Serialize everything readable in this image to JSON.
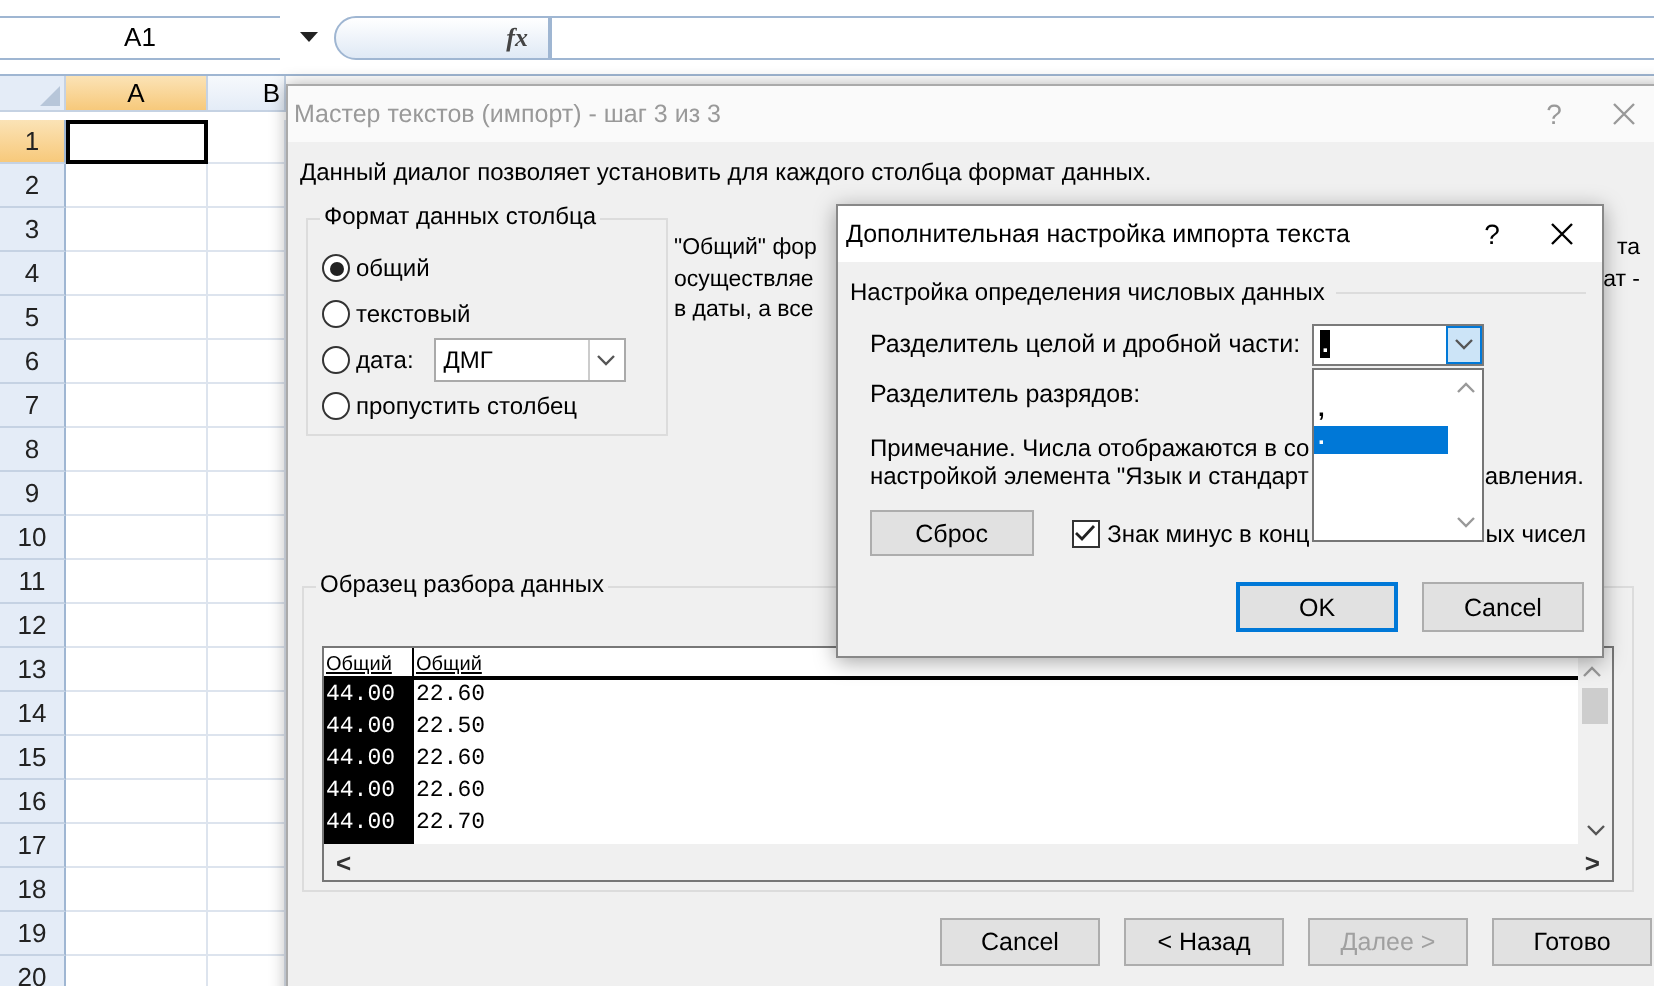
{
  "spreadsheet": {
    "name_box": "A1",
    "function_label": "fx",
    "columns": [
      {
        "label": "A",
        "selected": true
      },
      {
        "label": "B",
        "selected": false
      }
    ],
    "rows": [
      {
        "label": "1",
        "selected": true
      },
      {
        "label": "2",
        "selected": false
      },
      {
        "label": "3",
        "selected": false
      },
      {
        "label": "4",
        "selected": false
      },
      {
        "label": "5",
        "selected": false
      },
      {
        "label": "6",
        "selected": false
      },
      {
        "label": "7",
        "selected": false
      },
      {
        "label": "8",
        "selected": false
      },
      {
        "label": "9",
        "selected": false
      },
      {
        "label": "10",
        "selected": false
      },
      {
        "label": "11",
        "selected": false
      },
      {
        "label": "12",
        "selected": false
      },
      {
        "label": "13",
        "selected": false
      },
      {
        "label": "14",
        "selected": false
      },
      {
        "label": "15",
        "selected": false
      },
      {
        "label": "16",
        "selected": false
      },
      {
        "label": "17",
        "selected": false
      },
      {
        "label": "18",
        "selected": false
      },
      {
        "label": "19",
        "selected": false
      },
      {
        "label": "20",
        "selected": false
      }
    ]
  },
  "wizard": {
    "title": "Мастер текстов (импорт) - шаг 3 из 3",
    "help": "?",
    "intro": "Данный диалог позволяет установить для каждого столбца формат данных.",
    "format_group": {
      "legend": "Формат данных столбца",
      "date_format": "ДМГ",
      "options": [
        {
          "label": "общий",
          "selected": true,
          "kind": "plain"
        },
        {
          "label": "текстовый",
          "selected": false,
          "kind": "plain"
        },
        {
          "label": "дата:",
          "selected": false,
          "kind": "date"
        },
        {
          "label": "пропустить столбец",
          "selected": false,
          "kind": "plain"
        }
      ]
    },
    "description": {
      "left_lines": [
        "\"Общий\" фор",
        "осуществляе",
        "в даты, а все"
      ],
      "right_lines": [
        "та",
        "ат -"
      ]
    },
    "preview": {
      "legend": "Образец разбора данных",
      "columns": [
        {
          "header": "Общий",
          "selected": true,
          "values": [
            "44.00",
            "44.00",
            "44.00",
            "44.00",
            "44.00"
          ]
        },
        {
          "header": "Общий",
          "selected": false,
          "values": [
            "22.60",
            "22.50",
            "22.60",
            "22.60",
            "22.70"
          ]
        }
      ],
      "scroll_left": "<",
      "scroll_right": ">"
    },
    "buttons": [
      {
        "label": "Cancel",
        "disabled": false
      },
      {
        "label": "< Назад",
        "disabled": false
      },
      {
        "label": "Далее >",
        "disabled": true
      },
      {
        "label": "Готово",
        "disabled": false
      }
    ]
  },
  "advanced_dialog": {
    "title": "Дополнительная настройка импорта текста",
    "help": "?",
    "group_legend": "Настройка определения числовых данных",
    "decimal_separator": {
      "label": "Разделитель целой и дробной части:",
      "value": ".",
      "options": [
        {
          "label": ",",
          "selected": false
        },
        {
          "label": ".",
          "selected": true
        }
      ]
    },
    "thousands_separator": {
      "label": "Разделитель разрядов:"
    },
    "note_lines": [
      {
        "before": "Примечание. Числа отображаются в со"
      },
      {
        "before": "настройкой элемента \"Язык и стандарт",
        "after": "авления."
      }
    ],
    "reset": "Сброс",
    "minus_checkbox": {
      "checked": true,
      "before": "Знак минус в конц",
      "after": "ых чисел"
    },
    "buttons": [
      {
        "label": "OK",
        "default": true
      },
      {
        "label": "Cancel",
        "default": false
      }
    ]
  }
}
